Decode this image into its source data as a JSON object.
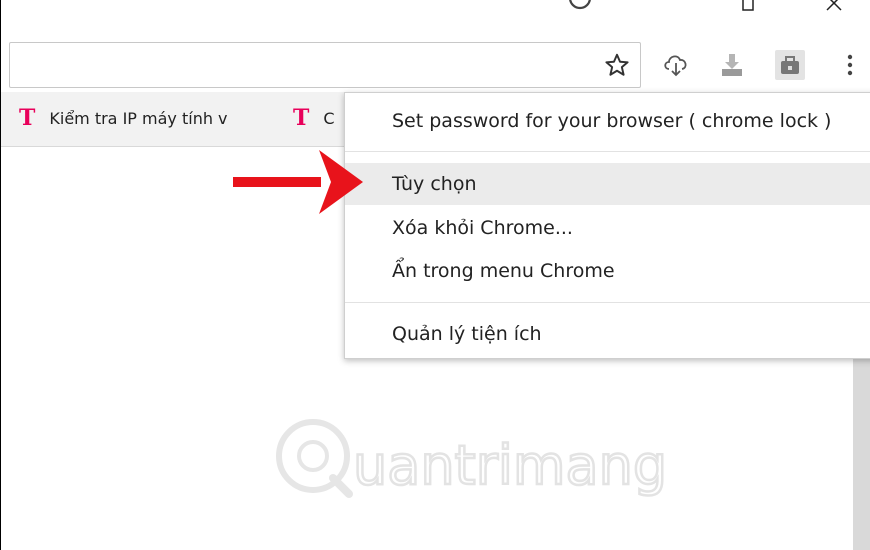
{
  "bookmarks": [
    {
      "label": "Kiểm tra IP máy tính v",
      "icon": "bookmark-t-icon"
    },
    {
      "label": "C",
      "icon": "bookmark-t-icon"
    }
  ],
  "menu": {
    "items": [
      {
        "label": "Set password for your browser ( chrome lock )"
      },
      {
        "label": "Tùy chọn"
      },
      {
        "label": "Xóa khỏi Chrome..."
      },
      {
        "label": "Ẩn trong menu Chrome"
      },
      {
        "label": "Quản lý tiện ích"
      }
    ],
    "highlighted_index": 1
  },
  "colors": {
    "bookmark_icon": "#e8005a",
    "arrow": "#e8131b",
    "menu_highlight": "#ebebeb"
  },
  "icons": [
    "star-icon",
    "cloud-download-icon",
    "download-icon",
    "lock-extension-icon",
    "more-vert-icon",
    "minimize-icon",
    "restore-icon",
    "close-icon"
  ]
}
